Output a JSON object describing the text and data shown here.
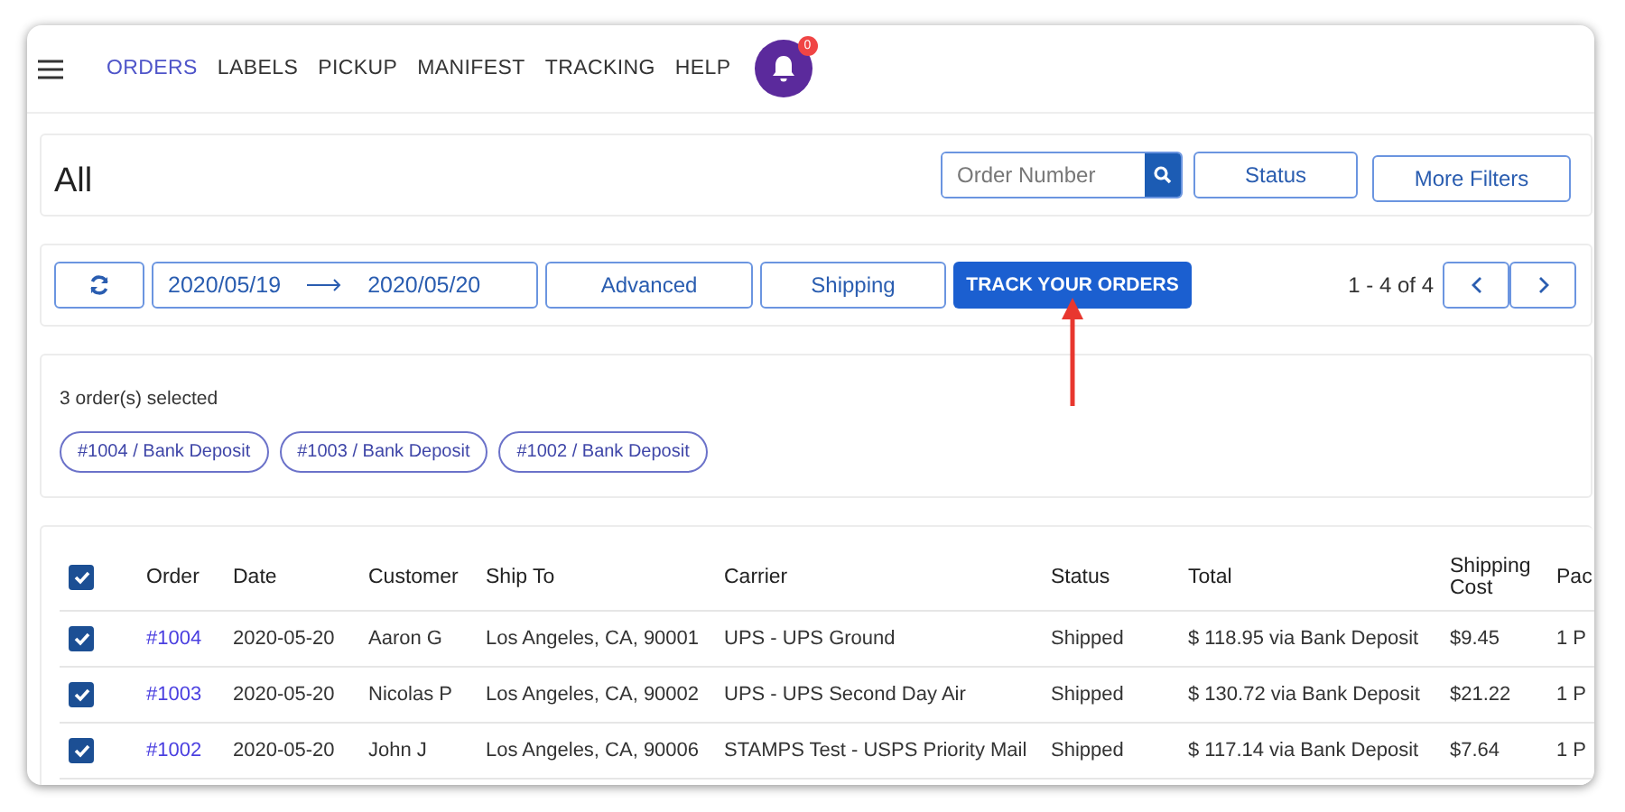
{
  "nav": {
    "items": [
      {
        "label": "ORDERS",
        "selected": true
      },
      {
        "label": "LABELS",
        "selected": false
      },
      {
        "label": "PICKUP",
        "selected": false
      },
      {
        "label": "MANIFEST",
        "selected": false
      },
      {
        "label": "TRACKING",
        "selected": false
      },
      {
        "label": "HELP",
        "selected": false
      }
    ],
    "notification_badge": "0"
  },
  "filters": {
    "title": "All",
    "search": {
      "placeholder": "Order Number"
    },
    "buttons": [
      "Status",
      "More Filters"
    ]
  },
  "toolbar": {
    "date_from": "2020/05/19",
    "date_to": "2020/05/20",
    "buttons": [
      {
        "label": "Advanced",
        "kind": "outline"
      },
      {
        "label": "Shipping",
        "kind": "outline"
      },
      {
        "label": "TRACK YOUR ORDERS",
        "kind": "primary"
      }
    ],
    "pagination": "1 - 4 of 4"
  },
  "selection": {
    "summary": "3 order(s) selected",
    "tags": [
      "#1004 / Bank Deposit",
      "#1003 / Bank Deposit",
      "#1002 / Bank Deposit"
    ]
  },
  "table": {
    "all_checked": true,
    "columns": [
      "Order",
      "Date",
      "Customer",
      "Ship To",
      "Carrier",
      "Status",
      "Total",
      "Shipping Cost",
      "Pac"
    ],
    "rows": [
      {
        "checked": true,
        "cells": [
          "#1004",
          "2020-05-20",
          "Aaron G",
          "Los Angeles, CA, 90001",
          "UPS - UPS Ground",
          "Shipped",
          "$ 118.95 via Bank Deposit",
          "$9.45",
          "1 P"
        ]
      },
      {
        "checked": true,
        "cells": [
          "#1003",
          "2020-05-20",
          "Nicolas P",
          "Los Angeles, CA, 90002",
          "UPS - UPS Second Day Air",
          "Shipped",
          "$ 130.72 via Bank Deposit",
          "$21.22",
          "1 P"
        ]
      },
      {
        "checked": true,
        "cells": [
          "#1002",
          "2020-05-20",
          "John J",
          "Los Angeles, CA, 90006",
          "STAMPS Test - USPS Priority Mail",
          "Shipped",
          "$ 117.14 via Bank Deposit",
          "$7.64",
          "1 P"
        ]
      }
    ]
  }
}
